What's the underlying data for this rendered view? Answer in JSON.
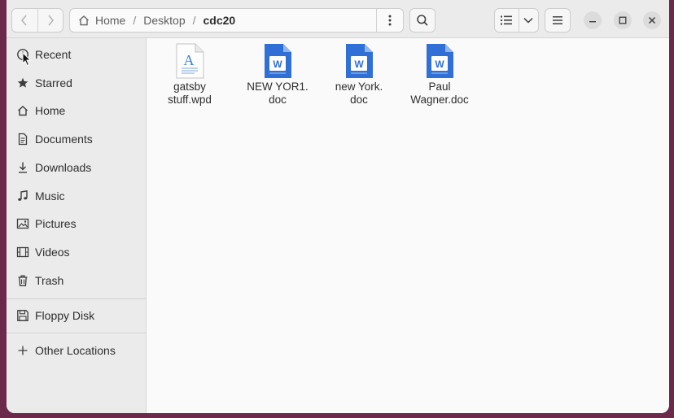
{
  "pathbar": {
    "crumbs": [
      "Home",
      "Desktop",
      "cdc20"
    ],
    "separator": "/"
  },
  "sidebar": {
    "places": [
      "Recent",
      "Starred",
      "Home",
      "Documents",
      "Downloads",
      "Music",
      "Pictures",
      "Videos",
      "Trash"
    ],
    "devices": [
      "Floppy Disk"
    ],
    "other": "Other Locations"
  },
  "files": [
    {
      "name": "gatsby\nstuff.wpd",
      "type": "text-document-icon"
    },
    {
      "name": "NEW YOR1.\ndoc",
      "type": "word-document-icon"
    },
    {
      "name": "new York.\ndoc",
      "type": "word-document-icon"
    },
    {
      "name": "Paul\nWagner.doc",
      "type": "word-document-icon"
    }
  ],
  "colors": {
    "word_blue": "#2f6fd6",
    "accent_text": "#3584e4",
    "desktop_bg": "#6b2a4c"
  }
}
